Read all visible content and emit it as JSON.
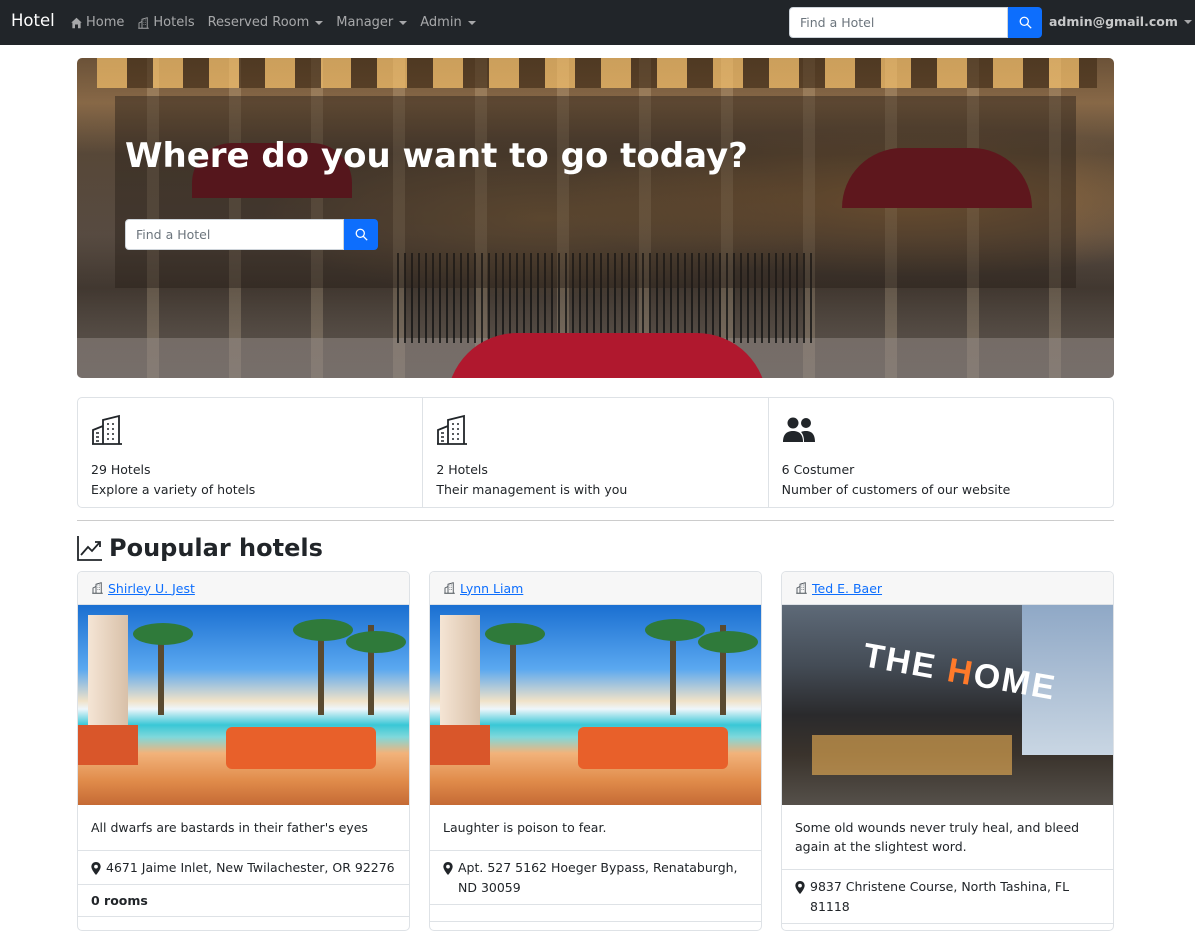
{
  "navbar": {
    "brand": "Hotel",
    "items": [
      {
        "label": "Home",
        "icon": "house-icon"
      },
      {
        "label": "Hotels",
        "icon": "building-icon"
      },
      {
        "label": "Reserved Room",
        "dropdown": true
      },
      {
        "label": "Manager",
        "dropdown": true
      },
      {
        "label": "Admin",
        "dropdown": true
      }
    ],
    "search_placeholder": "Find a Hotel",
    "user": "admin@gmail.com"
  },
  "hero": {
    "title": "Where do you want to go today?",
    "search_placeholder": "Find a Hotel"
  },
  "stats": [
    {
      "icon": "buildings-icon",
      "count": "29 Hotels",
      "desc": "Explore a variety of hotels"
    },
    {
      "icon": "buildings-icon",
      "count": "2 Hotels",
      "desc": "Their management is with you"
    },
    {
      "icon": "people-icon",
      "count": "6 Costumer",
      "desc": "Number of customers of our website"
    }
  ],
  "section": {
    "title": "Poupular hotels"
  },
  "cards": [
    {
      "name": "Shirley U. Jest",
      "image": "pool",
      "quote": "All dwarfs are bastards in their father's eyes",
      "address": "4671 Jaime Inlet, New Twilachester, OR 92276",
      "rooms": "0 rooms"
    },
    {
      "name": "Lynn Liam",
      "image": "pool",
      "quote": "Laughter is poison to fear.",
      "address": "Apt. 527 5162 Hoeger Bypass, Renataburgh, ND 30059",
      "rooms": ""
    },
    {
      "name": "Ted E. Baer",
      "image": "building",
      "quote": "Some old wounds never truly heal, and bleed again at the slightest word.",
      "address": "9837 Christene Course, North Tashina, FL 81118",
      "rooms": ""
    }
  ],
  "image_text": {
    "sign_t": "THE",
    "sign_h": "H",
    "sign_rest": "OME"
  },
  "colors": {
    "navbar": "#212529",
    "primary": "#0d6efd",
    "link": "#0d6efd"
  }
}
